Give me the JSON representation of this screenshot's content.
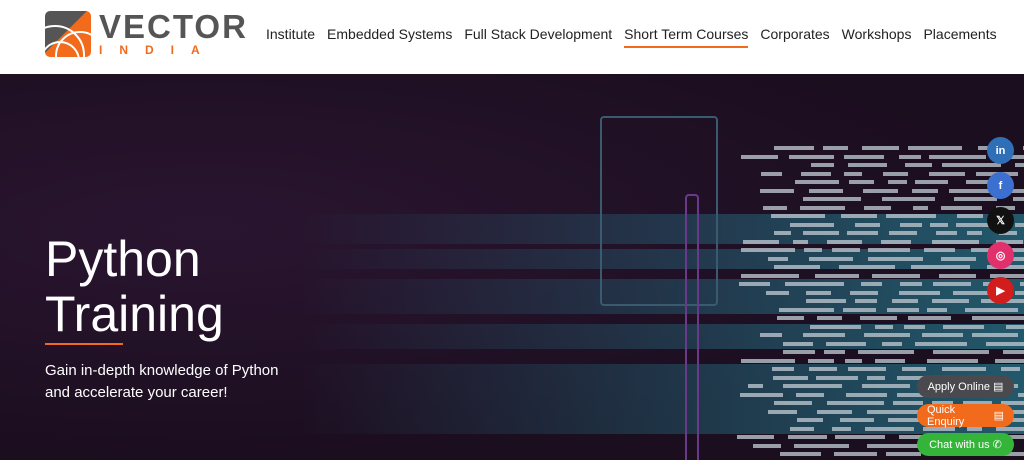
{
  "brand": {
    "name": "VECTOR",
    "sub": "INDIA",
    "accent": "#f26a1b"
  },
  "nav": [
    {
      "label": "Institute"
    },
    {
      "label": "Embedded Systems"
    },
    {
      "label": "Full Stack Development"
    },
    {
      "label": "Short Term Courses",
      "active": true
    },
    {
      "label": "Corporates"
    },
    {
      "label": "Workshops"
    },
    {
      "label": "Placements"
    }
  ],
  "hero": {
    "title_line1": "Python",
    "title_line2": "Training",
    "subtitle": "Gain in-depth knowledge of Python and accelerate your career!"
  },
  "social": [
    {
      "icon": "linkedin-icon",
      "glyph": "in",
      "color": "#2f6fb8"
    },
    {
      "icon": "facebook-icon",
      "glyph": "f",
      "color": "#3b6fd0"
    },
    {
      "icon": "x-icon",
      "glyph": "𝕏",
      "color": "#111111"
    },
    {
      "icon": "instagram-icon",
      "glyph": "◎",
      "color": "#e1306c"
    },
    {
      "icon": "youtube-icon",
      "glyph": "▶",
      "color": "#d21d1d"
    }
  ],
  "cta": {
    "apply": "Apply Online",
    "enquiry": "Quick Enquiry",
    "chat": "Chat with us"
  }
}
